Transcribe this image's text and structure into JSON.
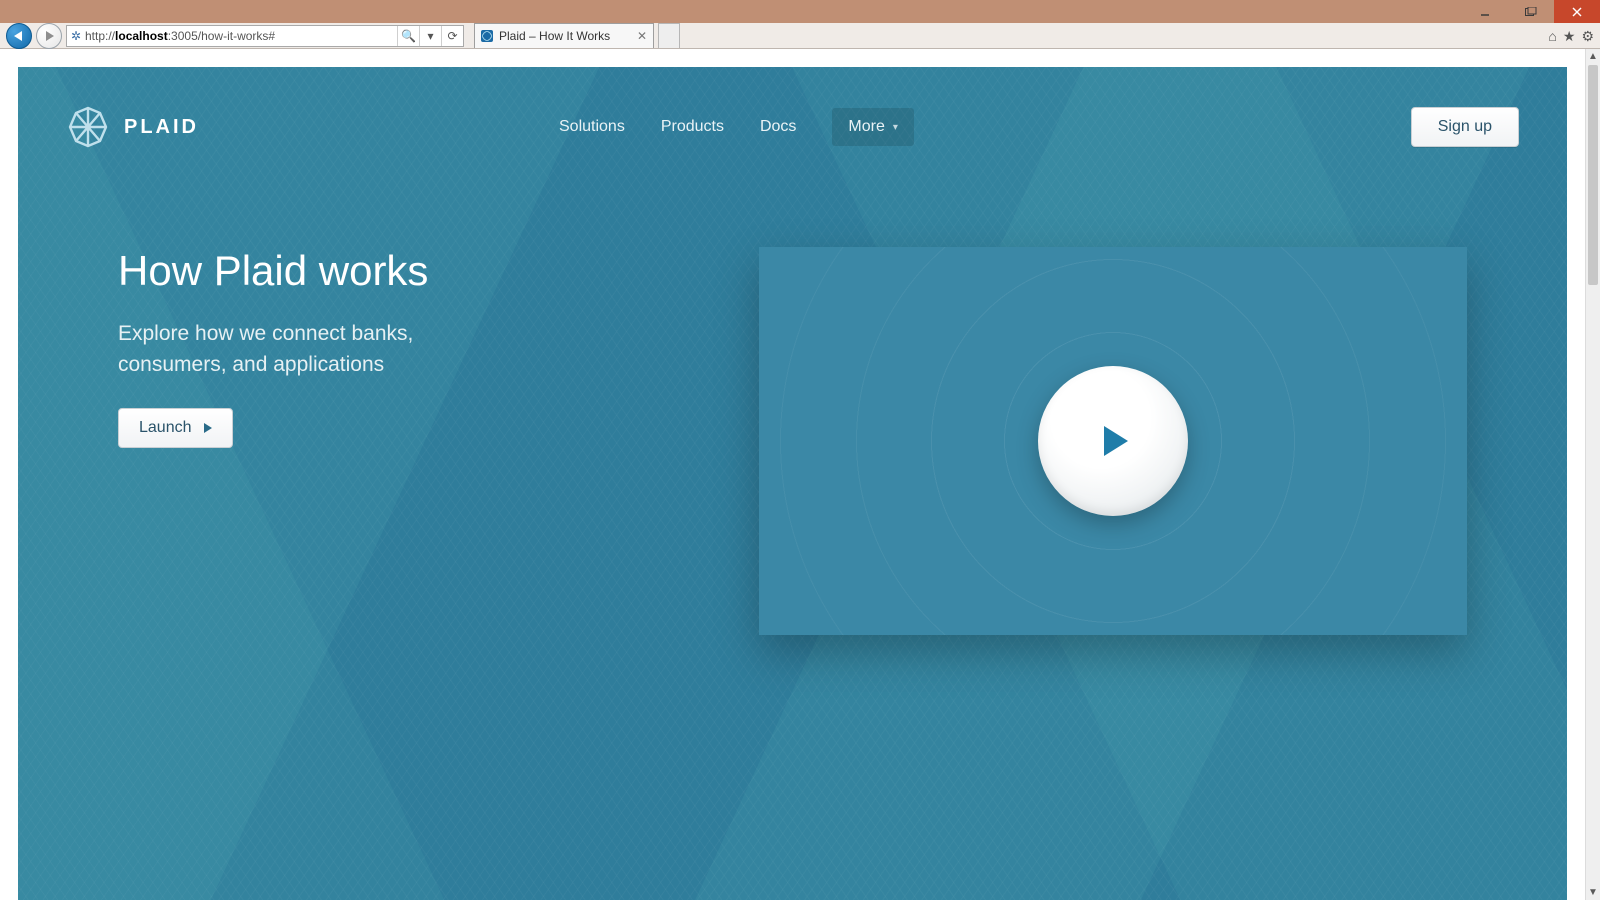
{
  "browser": {
    "url_prefix": "http://",
    "url_host": "localhost",
    "url_rest": ":3005/how-it-works#",
    "tab_title": "Plaid – How It Works"
  },
  "header": {
    "brand": "PLAID",
    "nav": {
      "solutions": "Solutions",
      "products": "Products",
      "docs": "Docs",
      "more": "More"
    },
    "signup": "Sign up"
  },
  "hero": {
    "heading": "How Plaid works",
    "subheading": "Explore how we connect banks, consumers, and applications",
    "launch": "Launch"
  }
}
